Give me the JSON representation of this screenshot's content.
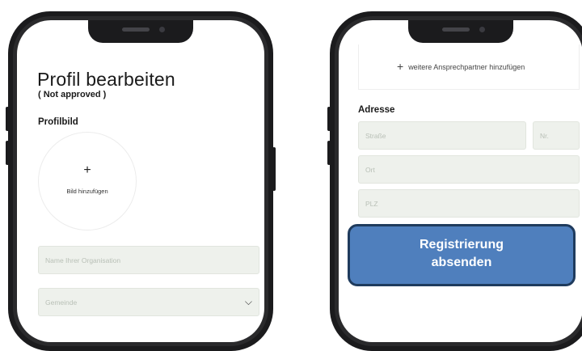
{
  "left_screen": {
    "title": "Profil bearbeiten",
    "status": "( Not approved )",
    "profile_image": {
      "section_label": "Profilbild",
      "plus": "+",
      "add_label": "Bild hinzufügen"
    },
    "organisation_placeholder": "Name Ihrer Organisation",
    "municipality_select": {
      "placeholder": "Gemeinde",
      "chevron_icon": "chevron-down-icon"
    }
  },
  "right_screen": {
    "add_contact_link": {
      "plus": "+",
      "label": "weitere Ansprechpartner hinzufügen"
    },
    "address": {
      "section_label": "Adresse",
      "street_placeholder": "Straße",
      "number_placeholder": "Nr.",
      "city_placeholder": "Ort",
      "zip_placeholder": "PLZ"
    }
  },
  "submit_button": {
    "line1": "Registrierung",
    "line2": "absenden"
  },
  "colors": {
    "button_fill": "#4f7fbd",
    "button_border": "#1f3b5d",
    "field_fill": "#eef1ec",
    "phone_frame": "#1b1b1d"
  }
}
